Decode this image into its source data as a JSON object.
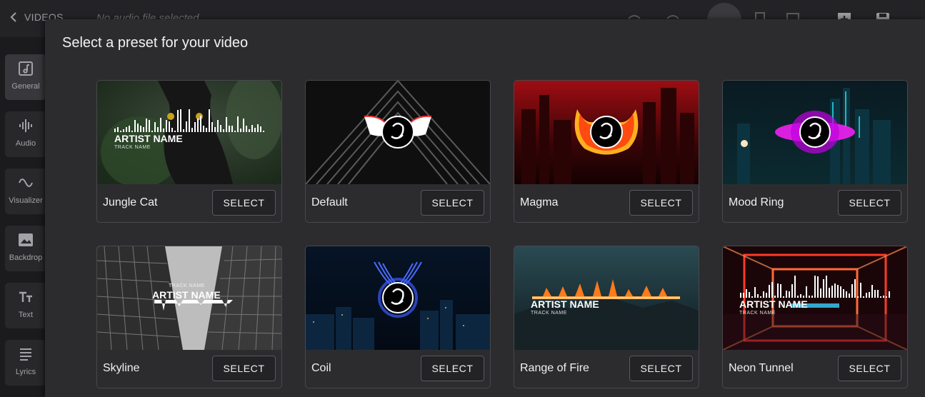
{
  "topbar": {
    "back_label": "VIDEOS",
    "audio_status": "No audio file selected"
  },
  "sidebar": {
    "items": [
      {
        "label": "General",
        "icon": "music-note-icon"
      },
      {
        "label": "Audio",
        "icon": "waveform-icon"
      },
      {
        "label": "Visualizer",
        "icon": "sine-wave-icon"
      },
      {
        "label": "Backdrop",
        "icon": "image-icon"
      },
      {
        "label": "Text",
        "icon": "text-icon"
      },
      {
        "label": "Lyrics",
        "icon": "lines-icon"
      }
    ]
  },
  "modal": {
    "title": "Select a preset for your video",
    "presets": [
      {
        "name": "Jungle Cat",
        "select_label": "SELECT",
        "overlay_title": "ARTIST NAME",
        "overlay_subtitle": "TRACK NAME"
      },
      {
        "name": "Default",
        "select_label": "SELECT"
      },
      {
        "name": "Magma",
        "select_label": "SELECT"
      },
      {
        "name": "Mood Ring",
        "select_label": "SELECT"
      },
      {
        "name": "Skyline",
        "select_label": "SELECT",
        "overlay_title": "ARTIST NAME",
        "overlay_subtitle": "TRACK NAME"
      },
      {
        "name": "Coil",
        "select_label": "SELECT"
      },
      {
        "name": "Range of Fire",
        "select_label": "SELECT",
        "overlay_title": "ARTIST NAME",
        "overlay_subtitle": "TRACK NAME"
      },
      {
        "name": "Neon Tunnel",
        "select_label": "SELECT",
        "overlay_title": "ARTIST NAME",
        "overlay_subtitle": "TRACK NAME"
      }
    ]
  },
  "colors": {
    "modal_bg": "#2c2c2f",
    "card_border": "#48484c",
    "magma_glow": "#ffb020",
    "mood_ring_glow": "#ff20ff",
    "coil_glow": "#4a6bff",
    "neon_glow": "#ff3a2a"
  }
}
